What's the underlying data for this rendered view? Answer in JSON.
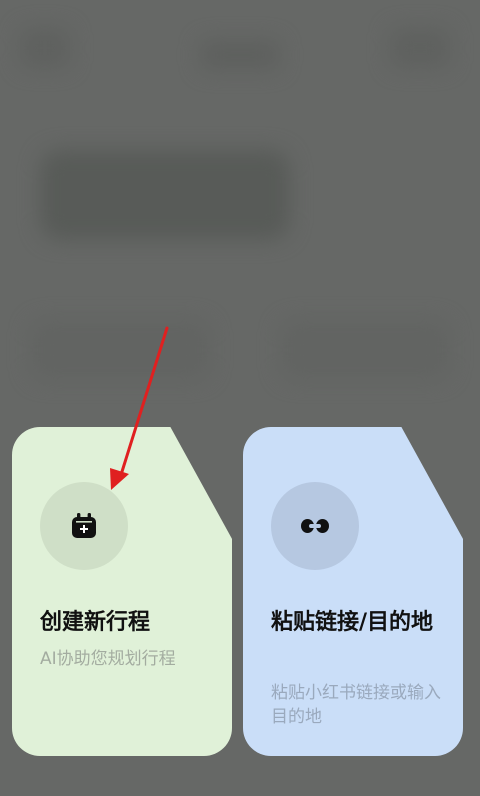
{
  "cards": [
    {
      "title": "创建新行程",
      "subtitle": "AI协助您规划行程",
      "icon": "calendar-plus-icon"
    },
    {
      "title": "粘贴链接/目的地",
      "subtitle": "粘贴小红书链接或输入目的地",
      "icon": "link-icon"
    }
  ],
  "colors": {
    "overlay": "#6a6c69",
    "card_green": "#e0f1d8",
    "card_blue": "#cadef8",
    "annotation_arrow": "#e02020"
  }
}
